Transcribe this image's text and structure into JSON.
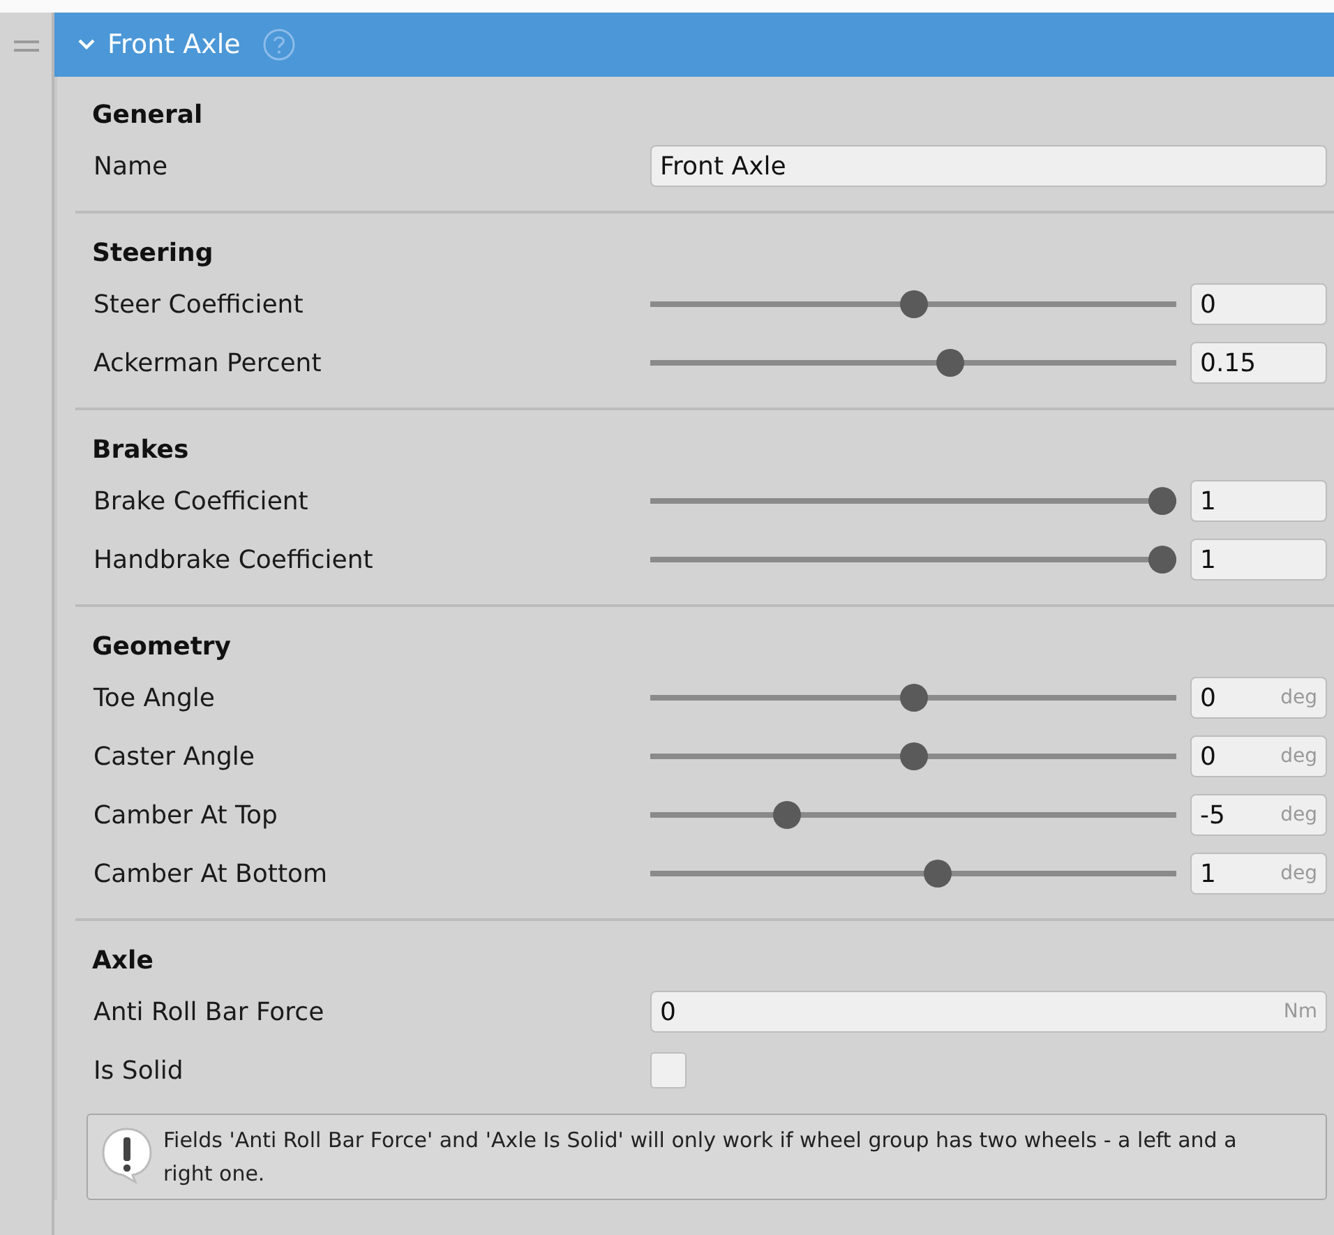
{
  "header": {
    "title": "Front Axle",
    "expanded": true
  },
  "sections": [
    {
      "title": "General",
      "rows": [
        {
          "kind": "text",
          "label": "Name",
          "value": "Front Axle"
        }
      ]
    },
    {
      "title": "Steering",
      "rows": [
        {
          "kind": "slider",
          "label": "Steer Coefficient",
          "level": 0.5,
          "value": "0"
        },
        {
          "kind": "slider",
          "label": "Ackerman Percent",
          "level": 0.575,
          "value": "0.15"
        }
      ]
    },
    {
      "title": "Brakes",
      "rows": [
        {
          "kind": "slider",
          "label": "Brake Coefficient",
          "level": 1,
          "value": "1"
        },
        {
          "kind": "slider",
          "label": "Handbrake Coefficient",
          "level": 1,
          "value": "1"
        }
      ]
    },
    {
      "title": "Geometry",
      "rows": [
        {
          "kind": "slider",
          "label": "Toe Angle",
          "level": 0.5,
          "value": "0",
          "unit": "deg"
        },
        {
          "kind": "slider",
          "label": "Caster Angle",
          "level": 0.5,
          "value": "0",
          "unit": "deg"
        },
        {
          "kind": "slider",
          "label": "Camber At Top",
          "level": 0.247,
          "value": "-5",
          "unit": "deg"
        },
        {
          "kind": "slider",
          "label": "Camber At Bottom",
          "level": 0.548,
          "value": "1",
          "unit": "deg"
        }
      ]
    },
    {
      "title": "Axle",
      "rows": [
        {
          "kind": "text",
          "label": "Anti Roll Bar Force",
          "value": "0",
          "unit": "Nm"
        },
        {
          "kind": "checkbox",
          "label": "Is Solid",
          "checked": false
        }
      ],
      "help": "Fields 'Anti Roll Bar Force' and 'Axle Is Solid' will only work if wheel group has two wheels - a left and a right one."
    }
  ]
}
